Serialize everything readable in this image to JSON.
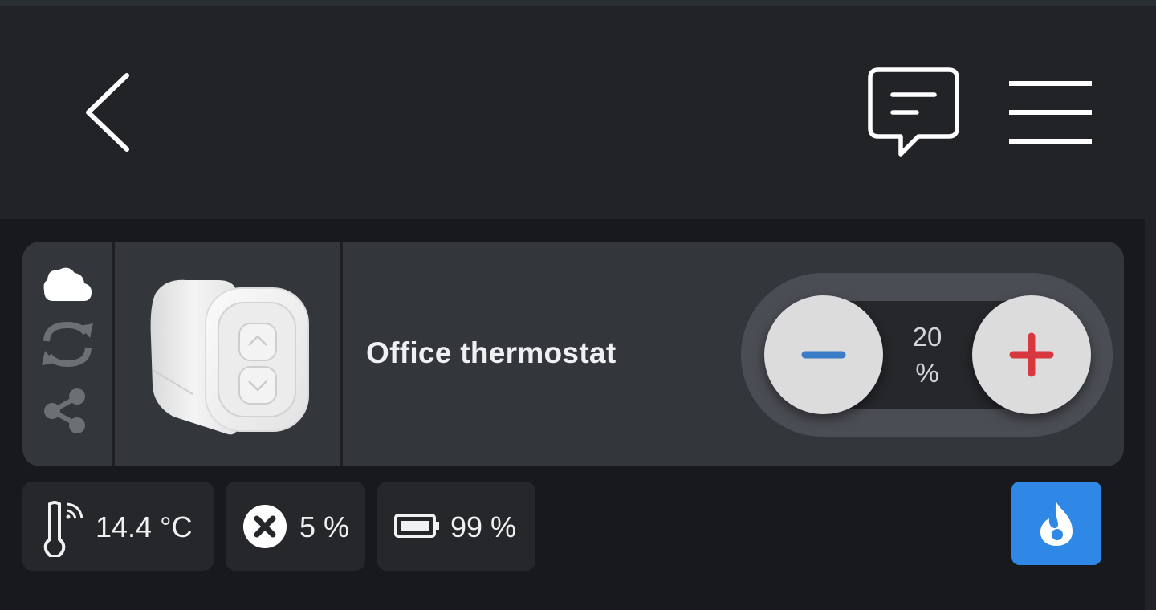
{
  "header": {
    "back_icon": "chevron-left-icon",
    "chat_icon": "message-icon",
    "menu_icon": "hamburger-menu-icon"
  },
  "device": {
    "name": "Office thermostat",
    "status_icons": [
      "cloud-icon",
      "sync-icon",
      "share-icon"
    ],
    "image": "thermostat-device-image"
  },
  "control": {
    "value": "20",
    "unit": "%",
    "decrease_icon": "minus-icon",
    "increase_icon": "plus-icon"
  },
  "readings": {
    "temperature": "14.4 °C",
    "valve": "5 %",
    "battery": "99 %"
  },
  "mode_icon": "flame-icon",
  "colors": {
    "accent_blue": "#2f87e6",
    "minus_blue": "#3a7cc6",
    "plus_red": "#d6383d",
    "card_bg": "#33363b",
    "header_bg": "#212327",
    "page_bg": "#17191c"
  }
}
